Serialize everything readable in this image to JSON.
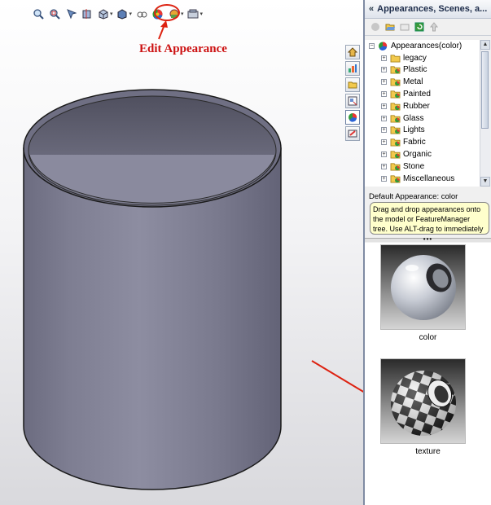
{
  "annotation": {
    "label": "Edit Appearance"
  },
  "toolbar": {
    "buttons": [
      "zoom-to-fit-icon",
      "zoom-to-area-icon",
      "previous-view-icon",
      "section-view-icon",
      "view-orientation-icon",
      "display-style-icon",
      "hide-show-items-icon",
      "edit-appearance-icon",
      "apply-scene-icon",
      "view-settings-icon"
    ]
  },
  "side_tabs": [
    "home-icon",
    "featuremanager-icon",
    "file-explorer-icon",
    "view-palette-icon",
    "appearances-icon",
    "custom-properties-icon"
  ],
  "panel": {
    "collapse_glyph": "«",
    "title": "Appearances, Scenes, a...",
    "tree_root": "Appearances(color)",
    "tree_items": [
      "legacy",
      "Plastic",
      "Metal",
      "Painted",
      "Rubber",
      "Glass",
      "Lights",
      "Fabric",
      "Organic",
      "Stone",
      "Miscellaneous"
    ],
    "status": "Default Appearance: color",
    "tooltip": "Drag and drop appearances onto the model or FeatureManager tree. Use ALT-drag to immediately edi...",
    "splitter_glyph": "•••",
    "swatches": [
      "color",
      "texture"
    ]
  },
  "colors": {
    "annotation": "#d21111",
    "cylinder": "#7e7e92",
    "panel_border": "#7f8ba3",
    "tooltip_bg": "#ffffcc"
  }
}
